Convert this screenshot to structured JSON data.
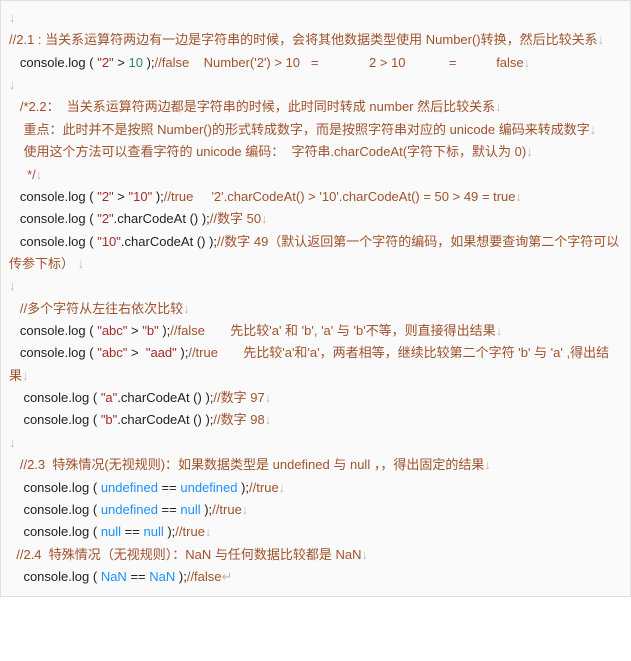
{
  "lines": [
    {
      "indent": "",
      "tokens": [
        {
          "c": "nl",
          "t": "↓"
        }
      ]
    },
    {
      "indent": "",
      "tokens": [
        {
          "c": "cm",
          "t": "//2.1 : 当关系运算符两边有一边是字符串的时候，会将其他数据类型使用 Number()转换，然后比较关系"
        },
        {
          "c": "nl",
          "t": "↓"
        }
      ]
    },
    {
      "indent": "   ",
      "tokens": [
        {
          "c": "fn",
          "t": "console"
        },
        {
          "c": "fn",
          "t": "."
        },
        {
          "c": "fn",
          "t": "log"
        },
        {
          "c": "fn",
          "t": " ( "
        },
        {
          "c": "str",
          "t": "\"2\""
        },
        {
          "c": "fn",
          "t": " > "
        },
        {
          "c": "num",
          "t": "10"
        },
        {
          "c": "fn",
          "t": " );"
        },
        {
          "c": "cm",
          "t": "//false    Number('2') > 10   =              2 > 10            =           false"
        },
        {
          "c": "nl",
          "t": "↓"
        }
      ]
    },
    {
      "indent": "",
      "tokens": [
        {
          "c": "nl",
          "t": "↓"
        }
      ]
    },
    {
      "indent": "   ",
      "tokens": [
        {
          "c": "cm",
          "t": "/*2.2：  当关系运算符两边都是字符串的时候，此时同时转成 number 然后比较关系"
        },
        {
          "c": "nl",
          "t": "↓"
        }
      ]
    },
    {
      "indent": "    ",
      "tokens": [
        {
          "c": "cm",
          "t": "重点：此时并不是按照 Number()的形式转成数字，而是按照字符串对应的 unicode 编码来转成数字"
        },
        {
          "c": "nl",
          "t": "↓"
        }
      ]
    },
    {
      "indent": "    ",
      "tokens": [
        {
          "c": "cm",
          "t": "使用这个方法可以查看字符的 unicode 编码：  字符串.charCodeAt(字符下标，默认为 0)"
        },
        {
          "c": "nl",
          "t": "↓"
        }
      ]
    },
    {
      "indent": "     ",
      "tokens": [
        {
          "c": "cm",
          "t": "*/"
        },
        {
          "c": "nl",
          "t": "↓"
        }
      ]
    },
    {
      "indent": "   ",
      "tokens": [
        {
          "c": "fn",
          "t": "console"
        },
        {
          "c": "fn",
          "t": "."
        },
        {
          "c": "fn",
          "t": "log"
        },
        {
          "c": "fn",
          "t": " ( "
        },
        {
          "c": "str",
          "t": "\"2\""
        },
        {
          "c": "fn",
          "t": " > "
        },
        {
          "c": "str",
          "t": "\"10\""
        },
        {
          "c": "fn",
          "t": " );"
        },
        {
          "c": "cm",
          "t": "//true     '2'.charCodeAt() > '10'.charCodeAt() = 50 > 49 = true"
        },
        {
          "c": "nl",
          "t": "↓"
        }
      ]
    },
    {
      "indent": "   ",
      "tokens": [
        {
          "c": "fn",
          "t": "console"
        },
        {
          "c": "fn",
          "t": "."
        },
        {
          "c": "fn",
          "t": "log"
        },
        {
          "c": "fn",
          "t": " ( "
        },
        {
          "c": "str",
          "t": "\"2\""
        },
        {
          "c": "fn",
          "t": "."
        },
        {
          "c": "fn",
          "t": "charCodeAt"
        },
        {
          "c": "fn",
          "t": " () );"
        },
        {
          "c": "cm",
          "t": "//数字 50"
        },
        {
          "c": "nl",
          "t": "↓"
        }
      ]
    },
    {
      "indent": "   ",
      "tokens": [
        {
          "c": "fn",
          "t": "console"
        },
        {
          "c": "fn",
          "t": "."
        },
        {
          "c": "fn",
          "t": "log"
        },
        {
          "c": "fn",
          "t": " ( "
        },
        {
          "c": "str",
          "t": "\"10\""
        },
        {
          "c": "fn",
          "t": "."
        },
        {
          "c": "fn",
          "t": "charCodeAt"
        },
        {
          "c": "fn",
          "t": " () );"
        },
        {
          "c": "cm",
          "t": "//数字 49（默认返回第一个字符的编码，如果想要查询第二个字符可以传参下标）"
        },
        {
          "c": "nl",
          "t": " ↓"
        }
      ]
    },
    {
      "indent": "",
      "tokens": [
        {
          "c": "nl",
          "t": "↓"
        }
      ]
    },
    {
      "indent": "   ",
      "tokens": [
        {
          "c": "cm",
          "t": "//多个字符从左往右依次比较"
        },
        {
          "c": "nl",
          "t": "↓"
        }
      ]
    },
    {
      "indent": "   ",
      "tokens": [
        {
          "c": "fn",
          "t": "console"
        },
        {
          "c": "fn",
          "t": "."
        },
        {
          "c": "fn",
          "t": "log"
        },
        {
          "c": "fn",
          "t": " ( "
        },
        {
          "c": "str",
          "t": "\"abc\""
        },
        {
          "c": "fn",
          "t": " > "
        },
        {
          "c": "str",
          "t": "\"b\""
        },
        {
          "c": "fn",
          "t": " );"
        },
        {
          "c": "cm",
          "t": "//false       先比较'a' 和 'b', 'a' 与 'b'不等，则直接得出结果"
        },
        {
          "c": "nl",
          "t": "↓"
        }
      ]
    },
    {
      "indent": "   ",
      "tokens": [
        {
          "c": "fn",
          "t": "console"
        },
        {
          "c": "fn",
          "t": "."
        },
        {
          "c": "fn",
          "t": "log"
        },
        {
          "c": "fn",
          "t": " ( "
        },
        {
          "c": "str",
          "t": "\"abc\""
        },
        {
          "c": "fn",
          "t": " >  "
        },
        {
          "c": "str",
          "t": "\"aad\""
        },
        {
          "c": "fn",
          "t": " );"
        },
        {
          "c": "cm",
          "t": "//true       先比较'a'和'a'，两者相等，继续比较第二个字符 'b' 与 'a' ,得出结果"
        },
        {
          "c": "nl",
          "t": "↓"
        }
      ]
    },
    {
      "indent": "    ",
      "tokens": [
        {
          "c": "fn",
          "t": "console"
        },
        {
          "c": "fn",
          "t": "."
        },
        {
          "c": "fn",
          "t": "log"
        },
        {
          "c": "fn",
          "t": " ( "
        },
        {
          "c": "str",
          "t": "\"a\""
        },
        {
          "c": "fn",
          "t": "."
        },
        {
          "c": "fn",
          "t": "charCodeAt"
        },
        {
          "c": "fn",
          "t": " () );"
        },
        {
          "c": "cm",
          "t": "//数字 97"
        },
        {
          "c": "nl",
          "t": "↓"
        }
      ]
    },
    {
      "indent": "    ",
      "tokens": [
        {
          "c": "fn",
          "t": "console"
        },
        {
          "c": "fn",
          "t": "."
        },
        {
          "c": "fn",
          "t": "log"
        },
        {
          "c": "fn",
          "t": " ( "
        },
        {
          "c": "str",
          "t": "\"b\""
        },
        {
          "c": "fn",
          "t": "."
        },
        {
          "c": "fn",
          "t": "charCodeAt"
        },
        {
          "c": "fn",
          "t": " () );"
        },
        {
          "c": "cm",
          "t": "//数字 98"
        },
        {
          "c": "nl",
          "t": "↓"
        }
      ]
    },
    {
      "indent": "",
      "tokens": [
        {
          "c": "nl",
          "t": "↓"
        }
      ]
    },
    {
      "indent": "   ",
      "tokens": [
        {
          "c": "cm",
          "t": "//2.3  特殊情况(无视规则)：如果数据类型是 undefined 与 null ，，得出固定的结果"
        },
        {
          "c": "nl",
          "t": "↓"
        }
      ]
    },
    {
      "indent": "    ",
      "tokens": [
        {
          "c": "fn",
          "t": "console"
        },
        {
          "c": "fn",
          "t": "."
        },
        {
          "c": "fn",
          "t": "log"
        },
        {
          "c": "fn",
          "t": " ( "
        },
        {
          "c": "kw",
          "t": "undefined"
        },
        {
          "c": "fn",
          "t": " == "
        },
        {
          "c": "kw",
          "t": "undefined"
        },
        {
          "c": "fn",
          "t": " );"
        },
        {
          "c": "cm",
          "t": "//true"
        },
        {
          "c": "nl",
          "t": "↓"
        }
      ]
    },
    {
      "indent": "    ",
      "tokens": [
        {
          "c": "fn",
          "t": "console"
        },
        {
          "c": "fn",
          "t": "."
        },
        {
          "c": "fn",
          "t": "log"
        },
        {
          "c": "fn",
          "t": " ( "
        },
        {
          "c": "kw",
          "t": "undefined"
        },
        {
          "c": "fn",
          "t": " == "
        },
        {
          "c": "kw",
          "t": "null"
        },
        {
          "c": "fn",
          "t": " );"
        },
        {
          "c": "cm",
          "t": "//true"
        },
        {
          "c": "nl",
          "t": "↓"
        }
      ]
    },
    {
      "indent": "    ",
      "tokens": [
        {
          "c": "fn",
          "t": "console"
        },
        {
          "c": "fn",
          "t": "."
        },
        {
          "c": "fn",
          "t": "log"
        },
        {
          "c": "fn",
          "t": " ( "
        },
        {
          "c": "kw",
          "t": "null"
        },
        {
          "c": "fn",
          "t": " == "
        },
        {
          "c": "kw",
          "t": "null"
        },
        {
          "c": "fn",
          "t": " );"
        },
        {
          "c": "cm",
          "t": "//true"
        },
        {
          "c": "nl",
          "t": "↓"
        }
      ]
    },
    {
      "indent": "  ",
      "tokens": [
        {
          "c": "cm",
          "t": "//2.4  特殊情况（无视规则）：NaN 与任何数据比较都是 NaN"
        },
        {
          "c": "nl",
          "t": "↓"
        }
      ]
    },
    {
      "indent": "    ",
      "tokens": [
        {
          "c": "fn",
          "t": "console"
        },
        {
          "c": "fn",
          "t": "."
        },
        {
          "c": "fn",
          "t": "log"
        },
        {
          "c": "fn",
          "t": " ( "
        },
        {
          "c": "kw",
          "t": "NaN"
        },
        {
          "c": "fn",
          "t": " == "
        },
        {
          "c": "kw",
          "t": "NaN"
        },
        {
          "c": "fn",
          "t": " );"
        },
        {
          "c": "cm",
          "t": "//false"
        },
        {
          "c": "nl",
          "t": "↵"
        }
      ]
    }
  ]
}
